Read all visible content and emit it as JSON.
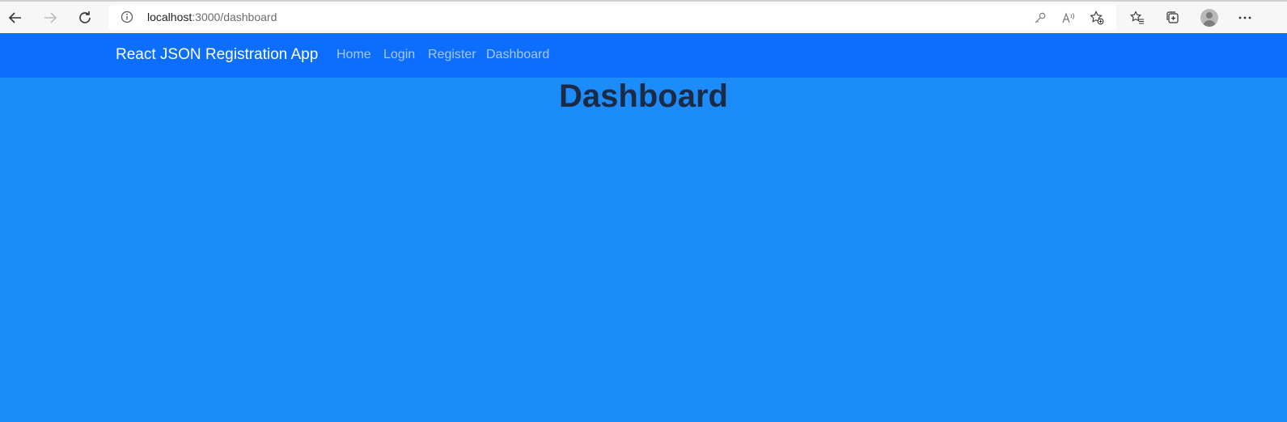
{
  "browser": {
    "url_host": "localhost",
    "url_path": ":3000/dashboard"
  },
  "app": {
    "brand": "React JSON Registration App",
    "nav": [
      {
        "label": "Home"
      },
      {
        "label": "Login"
      },
      {
        "label": "Register"
      },
      {
        "label": "Dashboard"
      }
    ]
  },
  "main": {
    "title": "Dashboard"
  },
  "colors": {
    "page_background": "#1b8cf9",
    "navbar_background": "#0d6efd",
    "title_color": "#1a2b45"
  },
  "icons": {
    "back": "back-arrow-icon",
    "forward": "forward-arrow-icon",
    "refresh": "refresh-icon",
    "site_info": "info-icon",
    "password": "key-icon",
    "read_aloud": "read-aloud-icon",
    "add_favorite": "star-add-icon",
    "favorites": "favorites-icon",
    "collections": "collections-icon",
    "profile": "avatar",
    "more": "more-icon"
  }
}
